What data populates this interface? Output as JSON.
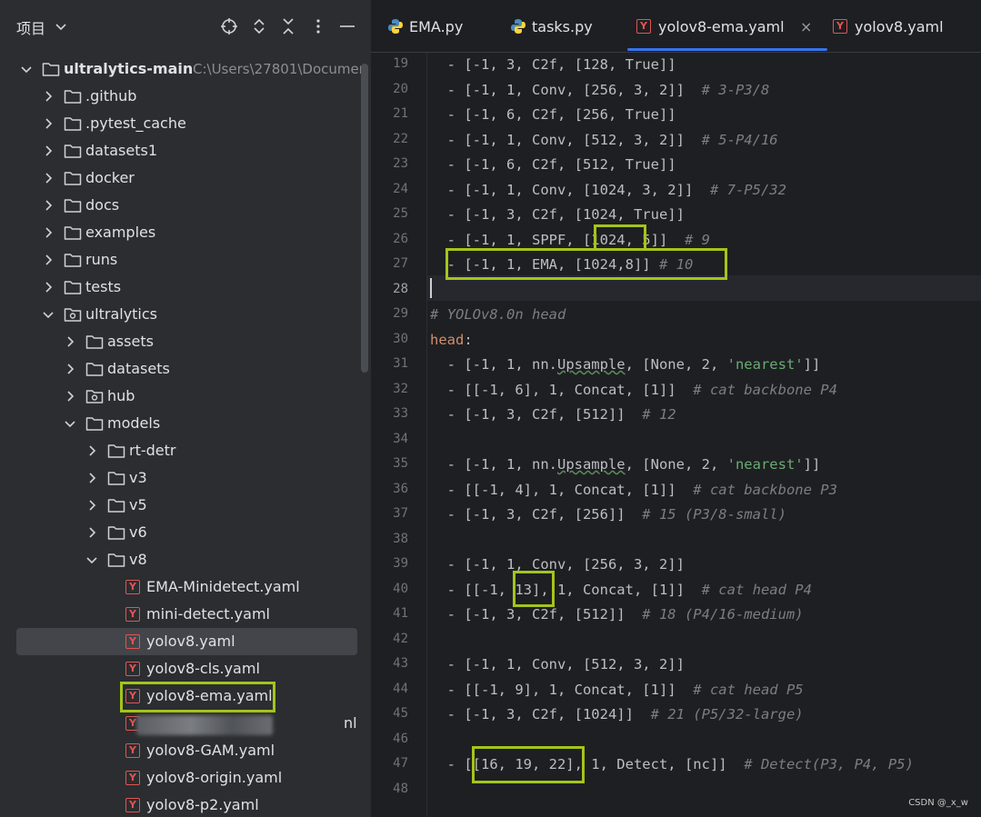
{
  "panel": {
    "title": "项目",
    "tree": [
      {
        "label": "ultralytics-main",
        "path": "C:\\Users\\27801\\Documen",
        "indent": 0,
        "expanded": true,
        "kind": "folder",
        "bold": true
      },
      {
        "label": ".github",
        "indent": 1,
        "expanded": false,
        "kind": "folder"
      },
      {
        "label": ".pytest_cache",
        "indent": 1,
        "expanded": false,
        "kind": "folder"
      },
      {
        "label": "datasets1",
        "indent": 1,
        "expanded": false,
        "kind": "folder"
      },
      {
        "label": "docker",
        "indent": 1,
        "expanded": false,
        "kind": "folder"
      },
      {
        "label": "docs",
        "indent": 1,
        "expanded": false,
        "kind": "folder"
      },
      {
        "label": "examples",
        "indent": 1,
        "expanded": false,
        "kind": "folder"
      },
      {
        "label": "runs",
        "indent": 1,
        "expanded": false,
        "kind": "folder"
      },
      {
        "label": "tests",
        "indent": 1,
        "expanded": false,
        "kind": "folder"
      },
      {
        "label": "ultralytics",
        "indent": 1,
        "expanded": true,
        "kind": "package"
      },
      {
        "label": "assets",
        "indent": 2,
        "expanded": false,
        "kind": "folder"
      },
      {
        "label": "datasets",
        "indent": 2,
        "expanded": false,
        "kind": "folder"
      },
      {
        "label": "hub",
        "indent": 2,
        "expanded": false,
        "kind": "package"
      },
      {
        "label": "models",
        "indent": 2,
        "expanded": true,
        "kind": "folder"
      },
      {
        "label": "rt-detr",
        "indent": 3,
        "expanded": false,
        "kind": "folder"
      },
      {
        "label": "v3",
        "indent": 3,
        "expanded": false,
        "kind": "folder"
      },
      {
        "label": "v5",
        "indent": 3,
        "expanded": false,
        "kind": "folder"
      },
      {
        "label": "v6",
        "indent": 3,
        "expanded": false,
        "kind": "folder"
      },
      {
        "label": "v8",
        "indent": 3,
        "expanded": true,
        "kind": "folder"
      },
      {
        "label": "EMA-Minidetect.yaml",
        "indent": 4,
        "kind": "yaml"
      },
      {
        "label": "mini-detect.yaml",
        "indent": 4,
        "kind": "yaml"
      },
      {
        "label": "yolov8.yaml",
        "indent": 4,
        "kind": "yaml",
        "selected": true
      },
      {
        "label": "yolov8-cls.yaml",
        "indent": 4,
        "kind": "yaml"
      },
      {
        "label": "yolov8-ema.yaml",
        "indent": 4,
        "kind": "yaml",
        "highlighted": true
      },
      {
        "label": "nl",
        "indent": 4,
        "kind": "yaml",
        "blurred": true
      },
      {
        "label": "yolov8-GAM.yaml",
        "indent": 4,
        "kind": "yaml"
      },
      {
        "label": "yolov8-origin.yaml",
        "indent": 4,
        "kind": "yaml"
      },
      {
        "label": "yolov8-p2.yaml",
        "indent": 4,
        "kind": "yaml"
      }
    ]
  },
  "tabs": [
    {
      "label": "EMA.py",
      "icon": "python-icon",
      "active": false
    },
    {
      "label": "tasks.py",
      "icon": "python-icon",
      "active": false
    },
    {
      "label": "yolov8-ema.yaml",
      "icon": "yaml-icon",
      "active": true,
      "closable": true
    },
    {
      "label": "yolov8.yaml",
      "icon": "yaml-icon",
      "active": false
    }
  ],
  "editor": {
    "current_line": 28,
    "lines": [
      {
        "n": 19,
        "t": [
          [
            "p",
            "  - [-1, 3, C2f, [128, True]]"
          ]
        ]
      },
      {
        "n": 20,
        "t": [
          [
            "p",
            "  - [-1, 1, Conv, [256, 3, 2]]  "
          ],
          [
            "c",
            "# 3-P3/8"
          ]
        ]
      },
      {
        "n": 21,
        "t": [
          [
            "p",
            "  - [-1, 6, C2f, [256, True]]"
          ]
        ]
      },
      {
        "n": 22,
        "t": [
          [
            "p",
            "  - [-1, 1, Conv, [512, 3, 2]]  "
          ],
          [
            "c",
            "# 5-P4/16"
          ]
        ]
      },
      {
        "n": 23,
        "t": [
          [
            "p",
            "  - [-1, 6, C2f, [512, True]]"
          ]
        ]
      },
      {
        "n": 24,
        "t": [
          [
            "p",
            "  - [-1, 1, Conv, [1024, 3, 2]]  "
          ],
          [
            "c",
            "# 7-P5/32"
          ]
        ]
      },
      {
        "n": 25,
        "t": [
          [
            "p",
            "  - [-1, 3, C2f, [1024, True]]"
          ]
        ]
      },
      {
        "n": 26,
        "t": [
          [
            "p",
            "  - [-1, 1, SPPF, [1024, 5]]  "
          ],
          [
            "c",
            "# 9"
          ]
        ]
      },
      {
        "n": 27,
        "t": [
          [
            "p",
            "  - [-1, 1, EMA, [1024,8]] "
          ],
          [
            "c",
            "# 10"
          ]
        ]
      },
      {
        "n": 28,
        "t": [
          [
            "p",
            ""
          ]
        ]
      },
      {
        "n": 29,
        "t": [
          [
            "c",
            "# YOLOv8.0n head"
          ]
        ]
      },
      {
        "n": 30,
        "t": [
          [
            "k",
            "head"
          ],
          [
            "p",
            ":"
          ]
        ]
      },
      {
        "n": 31,
        "t": [
          [
            "p",
            "  - [-1, 1, nn."
          ],
          [
            "u",
            "Upsample"
          ],
          [
            "p",
            ", [None, 2, "
          ],
          [
            "s",
            "'nearest'"
          ],
          [
            "p",
            "]]"
          ]
        ]
      },
      {
        "n": 32,
        "t": [
          [
            "p",
            "  - [[-1, 6], 1, Concat, [1]]  "
          ],
          [
            "c",
            "# cat backbone P4"
          ]
        ]
      },
      {
        "n": 33,
        "t": [
          [
            "p",
            "  - [-1, 3, C2f, [512]]  "
          ],
          [
            "c",
            "# 12"
          ]
        ]
      },
      {
        "n": 34,
        "t": [
          [
            "p",
            ""
          ]
        ]
      },
      {
        "n": 35,
        "t": [
          [
            "p",
            "  - [-1, 1, nn."
          ],
          [
            "u",
            "Upsample"
          ],
          [
            "p",
            ", [None, 2, "
          ],
          [
            "s",
            "'nearest'"
          ],
          [
            "p",
            "]]"
          ]
        ]
      },
      {
        "n": 36,
        "t": [
          [
            "p",
            "  - [[-1, 4], 1, Concat, [1]]  "
          ],
          [
            "c",
            "# cat backbone P3"
          ]
        ]
      },
      {
        "n": 37,
        "t": [
          [
            "p",
            "  - [-1, 3, C2f, [256]]  "
          ],
          [
            "c",
            "# 15 (P3/8-small)"
          ]
        ]
      },
      {
        "n": 38,
        "t": [
          [
            "p",
            ""
          ]
        ]
      },
      {
        "n": 39,
        "t": [
          [
            "p",
            "  - [-1, 1, Conv, [256, 3, 2]]"
          ]
        ]
      },
      {
        "n": 40,
        "t": [
          [
            "p",
            "  - [[-1, 13], 1, Concat, [1]]  "
          ],
          [
            "c",
            "# cat head P4"
          ]
        ]
      },
      {
        "n": 41,
        "t": [
          [
            "p",
            "  - [-1, 3, C2f, [512]]  "
          ],
          [
            "c",
            "# 18 (P4/16-medium)"
          ]
        ]
      },
      {
        "n": 42,
        "t": [
          [
            "p",
            ""
          ]
        ]
      },
      {
        "n": 43,
        "t": [
          [
            "p",
            "  - [-1, 1, Conv, [512, 3, 2]]"
          ]
        ]
      },
      {
        "n": 44,
        "t": [
          [
            "p",
            "  - [[-1, 9], 1, Concat, [1]]  "
          ],
          [
            "c",
            "# cat head P5"
          ]
        ]
      },
      {
        "n": 45,
        "t": [
          [
            "p",
            "  - [-1, 3, C2f, [1024]]  "
          ],
          [
            "c",
            "# 21 (P5/32-large)"
          ]
        ]
      },
      {
        "n": 46,
        "t": [
          [
            "p",
            ""
          ]
        ]
      },
      {
        "n": 47,
        "t": [
          [
            "p",
            "  - [[16, 19, 22], 1, Detect, [nc]]  "
          ],
          [
            "c",
            "# Detect(P3, P4, P5)"
          ]
        ]
      },
      {
        "n": 48,
        "t": [
          [
            "p",
            ""
          ]
        ]
      }
    ]
  },
  "watermark": "CSDN @_x_w",
  "colors": {
    "accent": "#3574f0",
    "highlight_box": "#a3c51b",
    "yaml_icon": "#e05555"
  }
}
